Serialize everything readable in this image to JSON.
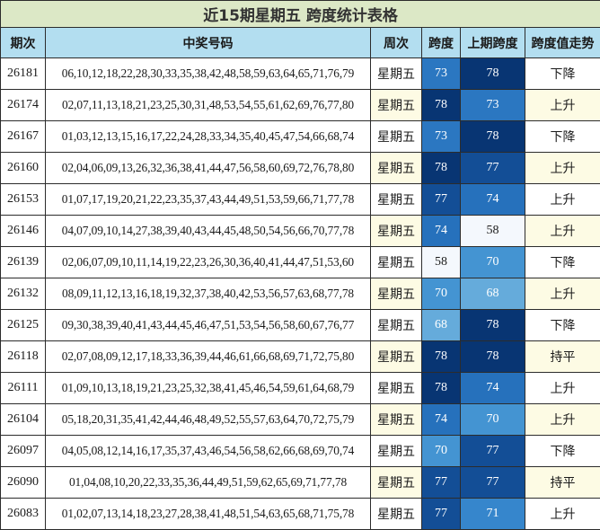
{
  "title": "近15期星期五 跨度统计表格",
  "headers": [
    "期次",
    "中奖号码",
    "周次",
    "跨度",
    "上期跨度",
    "跨度值走势"
  ],
  "colors": {
    "span_58": "#f4f8fd",
    "span_68": "#65abdb",
    "span_70": "#4494d2",
    "span_71": "#3686cc",
    "span_73": "#2b77c1",
    "span_74": "#2671bc",
    "span_77": "#134e96",
    "span_78": "#083573"
  },
  "rows": [
    {
      "period": "26181",
      "numbers": "06,10,12,18,22,28,30,33,35,38,42,48,58,59,63,64,65,71,76,79",
      "week": "星期五",
      "span": "73",
      "prev_span": "78",
      "trend": "下降"
    },
    {
      "period": "26174",
      "numbers": "02,07,11,13,18,21,23,25,30,31,48,53,54,55,61,62,69,76,77,80",
      "week": "星期五",
      "span": "78",
      "prev_span": "73",
      "trend": "上升"
    },
    {
      "period": "26167",
      "numbers": "01,03,12,13,15,16,17,22,24,28,33,34,35,40,45,47,54,66,68,74",
      "week": "星期五",
      "span": "73",
      "prev_span": "78",
      "trend": "下降"
    },
    {
      "period": "26160",
      "numbers": "02,04,06,09,13,26,32,36,38,41,44,47,56,58,60,69,72,76,78,80",
      "week": "星期五",
      "span": "78",
      "prev_span": "77",
      "trend": "上升"
    },
    {
      "period": "26153",
      "numbers": "01,07,17,19,20,21,22,23,35,37,43,44,49,51,53,59,66,71,77,78",
      "week": "星期五",
      "span": "77",
      "prev_span": "74",
      "trend": "上升"
    },
    {
      "period": "26146",
      "numbers": "04,07,09,10,14,27,38,39,40,43,44,45,48,50,54,56,66,70,77,78",
      "week": "星期五",
      "span": "74",
      "prev_span": "58",
      "trend": "上升"
    },
    {
      "period": "26139",
      "numbers": "02,06,07,09,10,11,14,19,22,23,26,30,36,40,41,44,47,51,53,60",
      "week": "星期五",
      "span": "58",
      "prev_span": "70",
      "trend": "下降"
    },
    {
      "period": "26132",
      "numbers": "08,09,11,12,13,16,18,19,32,37,38,40,42,53,56,57,63,68,77,78",
      "week": "星期五",
      "span": "70",
      "prev_span": "68",
      "trend": "上升"
    },
    {
      "period": "26125",
      "numbers": "09,30,38,39,40,41,43,44,45,46,47,51,53,54,56,58,60,67,76,77",
      "week": "星期五",
      "span": "68",
      "prev_span": "78",
      "trend": "下降"
    },
    {
      "period": "26118",
      "numbers": "02,07,08,09,12,17,18,33,36,39,44,46,61,66,68,69,71,72,75,80",
      "week": "星期五",
      "span": "78",
      "prev_span": "78",
      "trend": "持平"
    },
    {
      "period": "26111",
      "numbers": "01,09,10,13,18,19,21,23,25,32,38,41,45,46,54,59,61,64,68,79",
      "week": "星期五",
      "span": "78",
      "prev_span": "74",
      "trend": "上升"
    },
    {
      "period": "26104",
      "numbers": "05,18,20,31,35,41,42,44,46,48,49,52,55,57,63,64,70,72,75,79",
      "week": "星期五",
      "span": "74",
      "prev_span": "70",
      "trend": "上升"
    },
    {
      "period": "26097",
      "numbers": "04,05,08,12,14,16,17,35,37,43,46,54,56,58,62,66,68,69,70,74",
      "week": "星期五",
      "span": "70",
      "prev_span": "77",
      "trend": "下降"
    },
    {
      "period": "26090",
      "numbers": "01,04,08,10,20,22,33,35,36,44,49,51,59,62,65,69,71,77,78",
      "week": "星期五",
      "span": "77",
      "prev_span": "77",
      "trend": "持平"
    },
    {
      "period": "26083",
      "numbers": "01,02,07,13,14,18,23,27,28,38,41,48,51,54,63,65,68,71,75,78",
      "week": "星期五",
      "span": "77",
      "prev_span": "71",
      "trend": "上升"
    }
  ]
}
